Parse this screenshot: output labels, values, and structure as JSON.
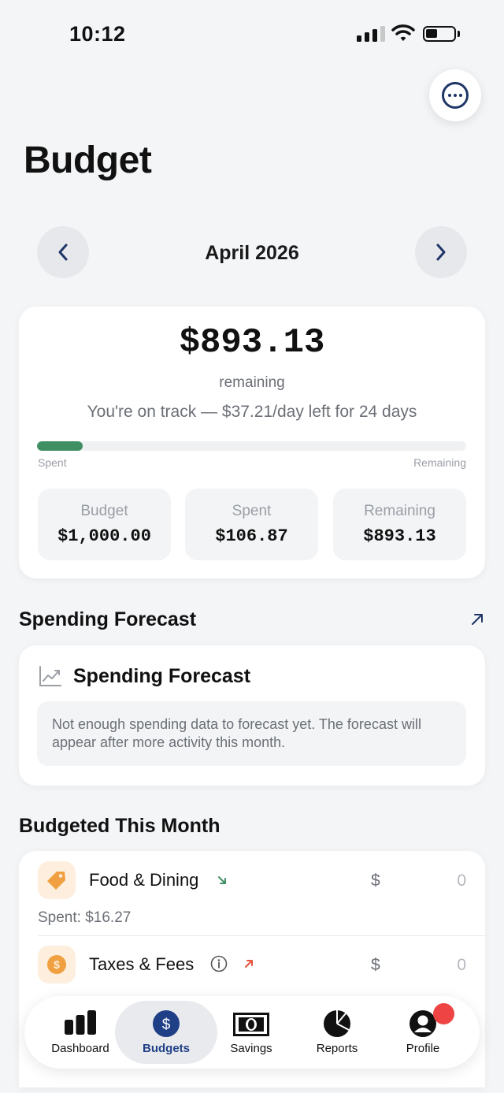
{
  "status_bar": {
    "time": "10:12"
  },
  "header": {
    "title": "Budget"
  },
  "month_nav": {
    "label": "April 2026"
  },
  "summary": {
    "remaining_amount": "$893.13",
    "remaining_word": "remaining",
    "message": "You're on track — $37.21/day left for 24 days",
    "progress_spent_fraction": 0.107,
    "progress_left_label": "Spent",
    "progress_right_label": "Remaining",
    "stats": [
      {
        "label": "Budget",
        "value": "$1,000.00"
      },
      {
        "label": "Spent",
        "value": "$106.87"
      },
      {
        "label": "Remaining",
        "value": "$893.13"
      }
    ]
  },
  "forecast_section": {
    "title": "Spending Forecast",
    "card_title": "Spending Forecast",
    "note": "Not enough spending data to forecast yet. The forecast will appear after more activity this month."
  },
  "budgeted_section": {
    "title": "Budgeted This Month",
    "items": [
      {
        "name": "Food & Dining",
        "currency": "$",
        "amount": "0",
        "spent": "Spent: $16.27",
        "trend": "down-right",
        "trend_color": "#3f8f64"
      },
      {
        "name": "Taxes & Fees",
        "currency": "$",
        "amount": "0",
        "trend": "up-right",
        "trend_color": "#e5533d"
      }
    ]
  },
  "tab_bar": {
    "tabs": [
      {
        "label": "Dashboard",
        "icon": "bar-chart-icon"
      },
      {
        "label": "Budgets",
        "icon": "dollar-circle-icon",
        "active": true
      },
      {
        "label": "Savings",
        "icon": "banknote-icon"
      },
      {
        "label": "Reports",
        "icon": "pie-chart-icon"
      },
      {
        "label": "Profile",
        "icon": "profile-icon",
        "badge": true
      }
    ]
  },
  "colors": {
    "accent": "#1f3f86",
    "progress": "#3f8f64",
    "badge": "#ef4444",
    "category_icon_bg": "#fdeedd",
    "category_icon": "#f0a040"
  }
}
